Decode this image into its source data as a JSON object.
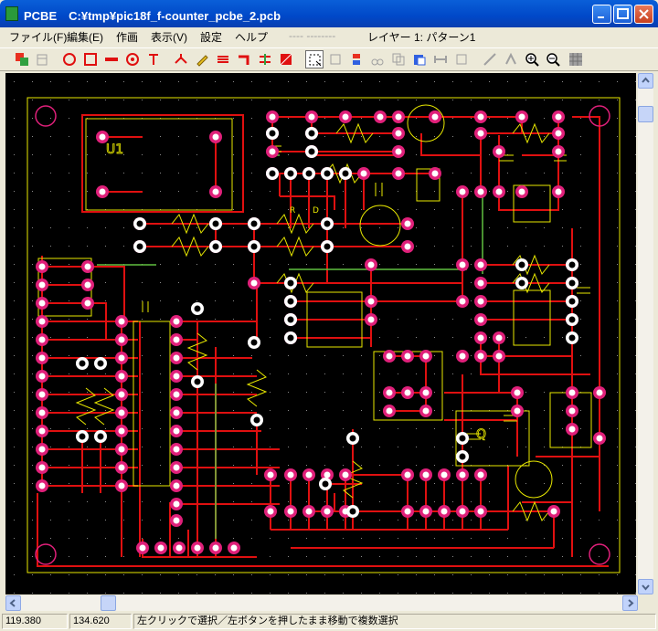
{
  "window": {
    "title": "PCBE　C:¥tmp¥pic18f_f-counter_pcbe_2.pcb"
  },
  "menu": {
    "items": [
      "ファイル(F)",
      "編集(E)",
      "作画",
      "表示(V)",
      "設定",
      "ヘルプ"
    ],
    "separator_dashes": "---- --------",
    "layer": "レイヤー 1: パターン1"
  },
  "toolbar": {
    "buttons": [
      "layers-icon",
      "trash-icon",
      "circle-pad-icon",
      "square-pad-icon",
      "line-pad-icon",
      "via-icon",
      "text-icon",
      "point-icon",
      "pen-icon",
      "bus-icon",
      "corner-icon",
      "jumper-icon",
      "fill-icon",
      "select-icon",
      "move-icon",
      "align-icon",
      "cut-icon",
      "copy-icon",
      "paste-icon",
      "flip-h-icon",
      "rotate-icon",
      "measure-icon",
      "connect-icon",
      "zoom-in-icon",
      "zoom-out-icon",
      "grid-icon"
    ]
  },
  "pcb": {
    "labels": {
      "u1": "U1",
      "q": "Q",
      "d": "D",
      "r": "R"
    },
    "colors": {
      "background": "#000000",
      "trace": "#e01010",
      "pad": "#e0207a",
      "pad_inner": "#ffffff",
      "silk": "#e8e800",
      "jumper": "#60c040",
      "board_outline": "#e8e800",
      "grid": "#8a8a8a"
    }
  },
  "status": {
    "x": "119.380",
    "y": "134.620",
    "message": "左クリックで選択／左ボタンを押したまま移動で複数選択"
  }
}
